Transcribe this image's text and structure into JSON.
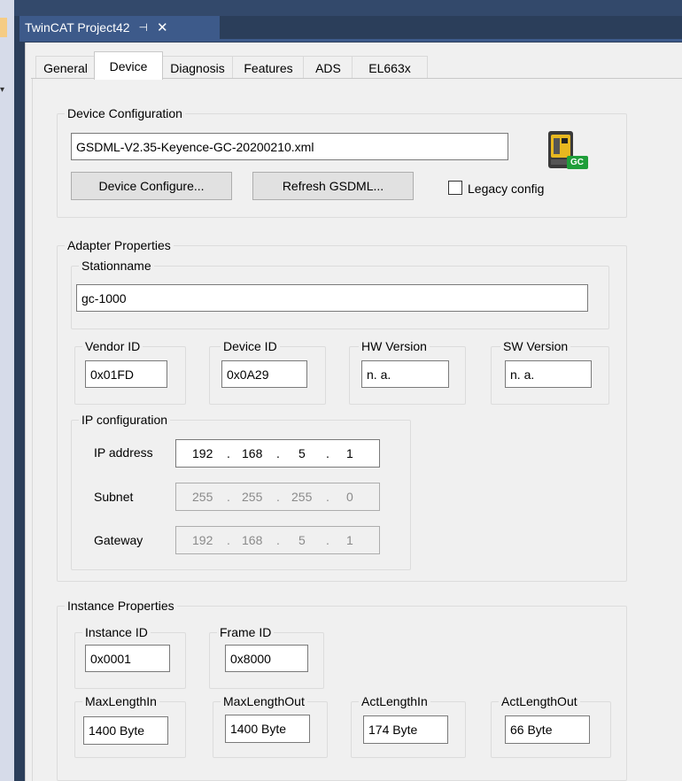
{
  "window": {
    "document_tab_title": "TwinCAT Project42",
    "pin_glyph": "⊣",
    "close_glyph": "✕"
  },
  "tabs": [
    "General",
    "Device",
    "Diagnosis",
    "Features",
    "ADS",
    "EL663x"
  ],
  "active_tab": "Device",
  "device_configuration": {
    "legend": "Device Configuration",
    "gsdml_file": "GSDML-V2.35-Keyence-GC-20200210.xml",
    "device_configure_button": "Device Configure...",
    "refresh_gsdml_button": "Refresh GSDML...",
    "legacy_config_label": "Legacy config",
    "legacy_config_checked": false,
    "device_icon_badge": "GC"
  },
  "adapter_properties": {
    "legend": "Adapter Properties",
    "stationname_legend": "Stationname",
    "stationname": "gc-1000",
    "vendor_id_legend": "Vendor ID",
    "vendor_id": "0x01FD",
    "device_id_legend": "Device ID",
    "device_id": "0x0A29",
    "hw_version_legend": "HW Version",
    "hw_version": "n. a.",
    "sw_version_legend": "SW Version",
    "sw_version": "n. a."
  },
  "ip_configuration": {
    "legend": "IP configuration",
    "ip_address_label": "IP address",
    "ip_address": [
      "192",
      "168",
      "5",
      "1"
    ],
    "subnet_label": "Subnet",
    "subnet": [
      "255",
      "255",
      "255",
      "0"
    ],
    "gateway_label": "Gateway",
    "gateway": [
      "192",
      "168",
      "5",
      "1"
    ],
    "separator": "."
  },
  "instance_properties": {
    "legend": "Instance Properties",
    "instance_id_legend": "Instance ID",
    "instance_id": "0x0001",
    "frame_id_legend": "Frame ID",
    "frame_id": "0x8000",
    "max_length_in_legend": "MaxLengthIn",
    "max_length_in": "1400 Byte",
    "max_length_out_legend": "MaxLengthOut",
    "max_length_out": "1400 Byte",
    "act_length_in_legend": "ActLengthIn",
    "act_length_in": "174 Byte",
    "act_length_out_legend": "ActLengthOut",
    "act_length_out": "66 Byte"
  },
  "colors": {
    "title_bar": "#3d5a8a",
    "panel_bg": "#f0f0f0",
    "badge_green": "#1f9e3a",
    "icon_yellow": "#e8b820"
  }
}
